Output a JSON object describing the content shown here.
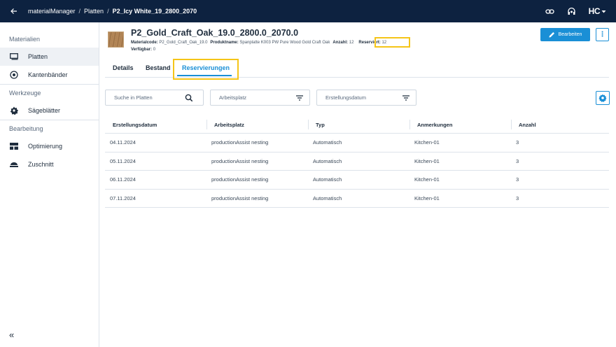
{
  "topbar": {
    "app_name": "materialManager",
    "crumb_sep": "/",
    "crumb_1": "Platten",
    "crumb_current": "P2_Icy White_19_2800_2070",
    "logo_text": "HC"
  },
  "sidebar": {
    "sections": [
      {
        "label": "Materialien"
      },
      {
        "label": "Werkzeuge"
      },
      {
        "label": "Bearbeitung"
      }
    ],
    "items": [
      {
        "label": "Platten",
        "icon": "board-icon"
      },
      {
        "label": "Kantenbänder",
        "icon": "edgeband-icon"
      },
      {
        "label": "Sägeblätter",
        "icon": "sawblade-icon"
      },
      {
        "label": "Optimierung",
        "icon": "optimization-icon"
      },
      {
        "label": "Zuschnitt",
        "icon": "cutting-icon"
      }
    ],
    "collapse_label": "«"
  },
  "header": {
    "title": "P2_Gold_Craft_Oak_19.0_2800.0_2070.0",
    "materialcode_label": "Materialcode:",
    "materialcode_value": "P2_Gold_Craft_Oak_19.0",
    "produktname_label": "Produktname:",
    "produktname_value": "Spanplatte K003 PW Pure Wood Gold Craft Oak",
    "anzahl_label": "Anzahl:",
    "anzahl_value": "12",
    "reserviert_label": "Reserviert:",
    "reserviert_value": "12",
    "verfuegbar_label": "Verfügbar:",
    "verfuegbar_value": "0",
    "edit_label": "Bearbeiten",
    "more_label": "⋮"
  },
  "tabs": [
    {
      "label": "Details"
    },
    {
      "label": "Bestand"
    },
    {
      "label": "Reservierungen",
      "active": true
    }
  ],
  "filters": {
    "search_placeholder": "Suche in Platten",
    "arbeitsplatz_placeholder": "Arbeitsplatz",
    "datum_placeholder": "Erstellungsdatum"
  },
  "table": {
    "columns": [
      "Erstellungsdatum",
      "Arbeitsplatz",
      "Typ",
      "Anmerkungen",
      "Anzahl"
    ],
    "rows": [
      [
        "04.11.2024",
        "productionAssist nesting",
        "Automatisch",
        "Kitchen-01",
        "3"
      ],
      [
        "05.11.2024",
        "productionAssist nesting",
        "Automatisch",
        "Kitchen-01",
        "3"
      ],
      [
        "06.11.2024",
        "productionAssist nesting",
        "Automatisch",
        "Kitchen-01",
        "3"
      ],
      [
        "07.11.2024",
        "productionAssist nesting",
        "Automatisch",
        "Kitchen-01",
        "3"
      ]
    ]
  },
  "colors": {
    "topbar": "#0d2240",
    "accent": "#1a8fd6",
    "highlight": "#f5c518"
  }
}
